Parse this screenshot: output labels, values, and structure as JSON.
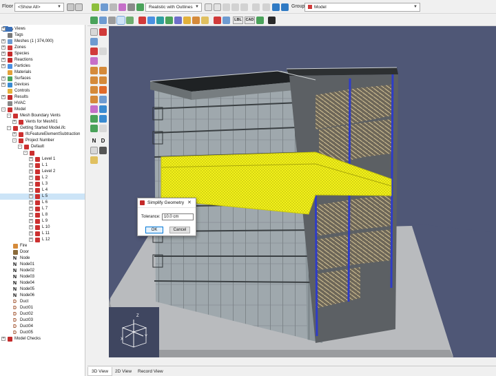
{
  "toolbar": {
    "floor_label": "Floor",
    "floor_value": "<Show All>",
    "render_mode": "Realistic with Outlines",
    "group_label": "Group:",
    "group_value": "Model",
    "lbl_button": "LBL",
    "cad_button": "CAD"
  },
  "tree": [
    {
      "label": "Views",
      "indent": 0,
      "exp": "+",
      "icon": "views"
    },
    {
      "label": "Tags",
      "indent": 0,
      "exp": "",
      "icon": "tag"
    },
    {
      "label": "Meshes (1 | 374,000)",
      "indent": 0,
      "exp": "+",
      "icon": "mesh"
    },
    {
      "label": "Zones",
      "indent": 0,
      "exp": "+",
      "icon": "zone"
    },
    {
      "label": "Species",
      "indent": 0,
      "exp": "+",
      "icon": "species"
    },
    {
      "label": "Reactions",
      "indent": 0,
      "exp": "+",
      "icon": "reaction"
    },
    {
      "label": "Particles",
      "indent": 0,
      "exp": "+",
      "icon": "particle"
    },
    {
      "label": "Materials",
      "indent": 0,
      "exp": "",
      "icon": "material"
    },
    {
      "label": "Surfaces",
      "indent": 0,
      "exp": "+",
      "icon": "surface"
    },
    {
      "label": "Devices",
      "indent": 0,
      "exp": "+",
      "icon": "device"
    },
    {
      "label": "Controls",
      "indent": 0,
      "exp": "",
      "icon": "control"
    },
    {
      "label": "Results",
      "indent": 0,
      "exp": "+",
      "icon": "results"
    },
    {
      "label": "HVAC",
      "indent": 0,
      "exp": "",
      "icon": "hvac"
    },
    {
      "label": "Model",
      "indent": 0,
      "exp": "-",
      "icon": "red"
    },
    {
      "label": "Mesh Boundary Vents",
      "indent": 1,
      "exp": "-",
      "icon": "red"
    },
    {
      "label": "Vents for Mesh01",
      "indent": 2,
      "exp": "+",
      "icon": "red"
    },
    {
      "label": "Getting Started Model.ifc",
      "indent": 1,
      "exp": "-",
      "icon": "red"
    },
    {
      "label": "IfcFeatureElementSubtraction",
      "indent": 2,
      "exp": "+",
      "icon": "red"
    },
    {
      "label": "Project Number",
      "indent": 2,
      "exp": "-",
      "icon": "red"
    },
    {
      "label": "Default",
      "indent": 3,
      "exp": "-",
      "icon": "red"
    },
    {
      "label": "",
      "indent": 4,
      "exp": "-",
      "icon": "red"
    },
    {
      "label": "Level 1",
      "indent": 5,
      "exp": "+",
      "icon": "red"
    },
    {
      "label": "L 1",
      "indent": 5,
      "exp": "+",
      "icon": "red"
    },
    {
      "label": "Level 2",
      "indent": 5,
      "exp": "+",
      "icon": "red"
    },
    {
      "label": "L 2",
      "indent": 5,
      "exp": "+",
      "icon": "red"
    },
    {
      "label": "L 3",
      "indent": 5,
      "exp": "+",
      "icon": "red"
    },
    {
      "label": "L 4",
      "indent": 5,
      "exp": "+",
      "icon": "red"
    },
    {
      "label": "L 5",
      "indent": 5,
      "exp": "+",
      "icon": "red",
      "selected": true
    },
    {
      "label": "L 6",
      "indent": 5,
      "exp": "+",
      "icon": "red"
    },
    {
      "label": "L 7",
      "indent": 5,
      "exp": "+",
      "icon": "red"
    },
    {
      "label": "L 8",
      "indent": 5,
      "exp": "+",
      "icon": "red"
    },
    {
      "label": "L 9",
      "indent": 5,
      "exp": "+",
      "icon": "red"
    },
    {
      "label": "L 10",
      "indent": 5,
      "exp": "+",
      "icon": "red"
    },
    {
      "label": "L 11",
      "indent": 5,
      "exp": "+",
      "icon": "red"
    },
    {
      "label": "L 12",
      "indent": 5,
      "exp": "+",
      "icon": "red"
    },
    {
      "label": "Fire",
      "indent": 1,
      "exp": "",
      "icon": "fire"
    },
    {
      "label": "Door",
      "indent": 1,
      "exp": "",
      "icon": "door"
    },
    {
      "label": "Node",
      "indent": 1,
      "exp": "",
      "icon": "node"
    },
    {
      "label": "Node01",
      "indent": 1,
      "exp": "",
      "icon": "node"
    },
    {
      "label": "Node02",
      "indent": 1,
      "exp": "",
      "icon": "node"
    },
    {
      "label": "Node03",
      "indent": 1,
      "exp": "",
      "icon": "node"
    },
    {
      "label": "Node04",
      "indent": 1,
      "exp": "",
      "icon": "node"
    },
    {
      "label": "Node05",
      "indent": 1,
      "exp": "",
      "icon": "node"
    },
    {
      "label": "Node06",
      "indent": 1,
      "exp": "",
      "icon": "node"
    },
    {
      "label": "Duct",
      "indent": 1,
      "exp": "",
      "icon": "duct"
    },
    {
      "label": "Duct01",
      "indent": 1,
      "exp": "",
      "icon": "duct"
    },
    {
      "label": "Duct02",
      "indent": 1,
      "exp": "",
      "icon": "duct"
    },
    {
      "label": "Duct03",
      "indent": 1,
      "exp": "",
      "icon": "duct"
    },
    {
      "label": "Duct04",
      "indent": 1,
      "exp": "",
      "icon": "duct"
    },
    {
      "label": "Duct05",
      "indent": 1,
      "exp": "",
      "icon": "duct"
    },
    {
      "label": "Model Checks",
      "indent": 0,
      "exp": "+",
      "icon": "checks"
    }
  ],
  "dialog": {
    "title": "Simplify Geometry",
    "close_glyph": "✕",
    "tolerance_label": "Tolerance:",
    "tolerance_value": "10.0 cm",
    "ok_label": "OK",
    "cancel_label": "Cancel"
  },
  "tabs": [
    "3D View",
    "2D View",
    "Record View"
  ],
  "active_tab": 0,
  "axes": {
    "x": "X",
    "y": "Y",
    "z": "Z"
  },
  "colors": {
    "viewport_bg": "#4f5776",
    "highlight": "#f3f21a",
    "selection": "#cce4f7",
    "accent": "#0078d7"
  }
}
